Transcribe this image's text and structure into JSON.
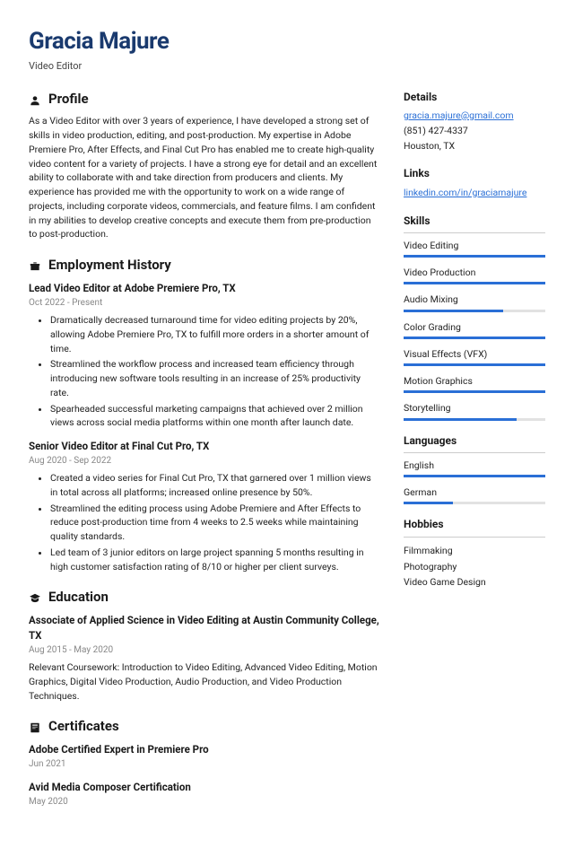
{
  "header": {
    "name": "Gracia Majure",
    "title": "Video Editor"
  },
  "sections": {
    "profile": {
      "heading": "Profile",
      "text": "As a Video Editor with over 3 years of experience, I have developed a strong set of skills in video production, editing, and post-production. My expertise in Adobe Premiere Pro, After Effects, and Final Cut Pro has enabled me to create high-quality video content for a variety of projects. I have a strong eye for detail and an excellent ability to collaborate with and take direction from producers and clients. My experience has provided me with the opportunity to work on a wide range of projects, including corporate videos, commercials, and feature films. I am confident in my abilities to develop creative concepts and execute them from pre-production to post-production."
    },
    "employment": {
      "heading": "Employment History",
      "jobs": [
        {
          "title": "Lead Video Editor at Adobe Premiere Pro, TX",
          "date": "Oct 2022 - Present",
          "bullets": [
            "Dramatically decreased turnaround time for video editing projects by 20%, allowing Adobe Premiere Pro, TX to fulfill more orders in a shorter amount of time.",
            "Streamlined the workflow process and increased team efficiency through introducing new software tools resulting in an increase of 25% productivity rate.",
            "Spearheaded successful marketing campaigns that achieved over 2 million views across social media platforms within one month after launch date."
          ]
        },
        {
          "title": "Senior Video Editor at Final Cut Pro, TX",
          "date": "Aug 2020 - Sep 2022",
          "bullets": [
            "Created a video series for Final Cut Pro, TX that garnered over 1 million views in total across all platforms; increased online presence by 50%.",
            "Streamlined the editing process using Adobe Premiere and After Effects to reduce post-production time from 4 weeks to 2.5 weeks while maintaining quality standards.",
            "Led team of 3 junior editors on large project spanning 5 months resulting in high customer satisfaction rating of 8/10 or higher per client surveys."
          ]
        }
      ]
    },
    "education": {
      "heading": "Education",
      "items": [
        {
          "title": "Associate of Applied Science in Video Editing at Austin Community College, TX",
          "date": "Aug 2015 - May 2020",
          "desc": "Relevant Coursework: Introduction to Video Editing, Advanced Video Editing, Motion Graphics, Digital Video Production, Audio Production, and Video Production Techniques."
        }
      ]
    },
    "certificates": {
      "heading": "Certificates",
      "items": [
        {
          "title": "Adobe Certified Expert in Premiere Pro",
          "date": "Jun 2021"
        },
        {
          "title": "Avid Media Composer Certification",
          "date": "May 2020"
        }
      ]
    }
  },
  "sidebar": {
    "details": {
      "heading": "Details",
      "email": "gracia.majure@gmail.com",
      "phone": "(851) 427-4337",
      "location": "Houston, TX"
    },
    "links": {
      "heading": "Links",
      "items": [
        "linkedin.com/in/graciamajure"
      ]
    },
    "skills": {
      "heading": "Skills",
      "items": [
        {
          "label": "Video Editing",
          "level": 100
        },
        {
          "label": "Video Production",
          "level": 100
        },
        {
          "label": "Audio Mixing",
          "level": 70
        },
        {
          "label": "Color Grading",
          "level": 100
        },
        {
          "label": "Visual Effects (VFX)",
          "level": 100
        },
        {
          "label": "Motion Graphics",
          "level": 100
        },
        {
          "label": "Storytelling",
          "level": 80
        }
      ]
    },
    "languages": {
      "heading": "Languages",
      "items": [
        {
          "label": "English",
          "level": 100
        },
        {
          "label": "German",
          "level": 35
        }
      ]
    },
    "hobbies": {
      "heading": "Hobbies",
      "items": [
        "Filmmaking",
        "Photography",
        "Video Game Design"
      ]
    }
  }
}
